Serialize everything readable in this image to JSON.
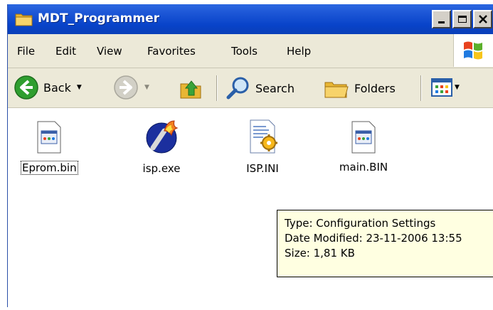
{
  "window": {
    "title": "MDT_Programmer",
    "buttons": {
      "minimize": "_",
      "maximize": "□",
      "close": "✕"
    }
  },
  "menubar": {
    "items": [
      "File",
      "Edit",
      "View",
      "Favorites",
      "Tools",
      "Help"
    ]
  },
  "toolbar": {
    "back_label": "Back",
    "search_label": "Search",
    "folders_label": "Folders"
  },
  "files": [
    {
      "name": "Eprom.bin",
      "icon": "bin-file-icon",
      "selected": true
    },
    {
      "name": "isp.exe",
      "icon": "isp-exe-icon",
      "selected": false
    },
    {
      "name": "ISP.INI",
      "icon": "config-file-icon",
      "selected": false
    },
    {
      "name": "main.BIN",
      "icon": "bin-file-icon",
      "selected": false
    }
  ],
  "tooltip": {
    "type": "Type: Configuration Settings",
    "date_modified": "Date Modified: 23-11-2006 13:55",
    "size": "Size: 1,81 KB"
  },
  "colors": {
    "titlebar": "#0a46c8",
    "chrome": "#ece9d8",
    "tooltip_bg": "#ffffe1",
    "back_green": "#2f9e2f"
  }
}
